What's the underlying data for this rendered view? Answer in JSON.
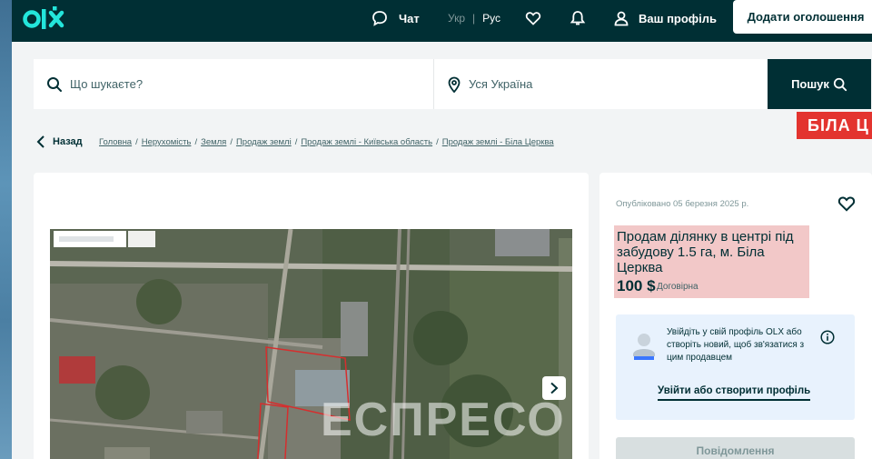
{
  "header": {
    "logo_text": "olx",
    "chat_label": "Чат",
    "lang_ukr": "Укр",
    "lang_sep": "|",
    "lang_rus": "Рус",
    "profile_label": "Ваш профіль",
    "add_button": "Додати оголошення"
  },
  "search": {
    "query_placeholder": "Що шукаєте?",
    "location_value": "Уся Україна",
    "button_label": "Пошук"
  },
  "promo_text": "БІЛА Ц",
  "breadcrumbs": {
    "back_label": "Назад",
    "items": [
      "Головна",
      "Нерухомість",
      "Земля",
      "Продаж землі",
      "Продаж землі - Київська область",
      "Продаж землі - Біла Церква"
    ],
    "separator": "/"
  },
  "gallery": {
    "watermark": "ЕСПРЕСО",
    "map_search_hint": "Search Google Maps"
  },
  "listing": {
    "published": "Опубліковано 05 березня 2025 р.",
    "title": "Продам ділянку в центрі під забудову 1.5 га, м. Біла Церква",
    "price": "100 $",
    "negotiable": "Договірна"
  },
  "login_prompt": {
    "text": "Увійдіть у свій профіль OLX або створіть новий, щоб зв'язатися з цим продавцем",
    "link": "Увійти або створити профіль"
  },
  "message_button": "Повідомлення",
  "colors": {
    "brand_dark": "#002f34",
    "logo_accent": "#23e5db",
    "promo_red": "#e3342f",
    "title_highlight": "#f2c8c8",
    "login_bg": "#e8f2fd"
  }
}
